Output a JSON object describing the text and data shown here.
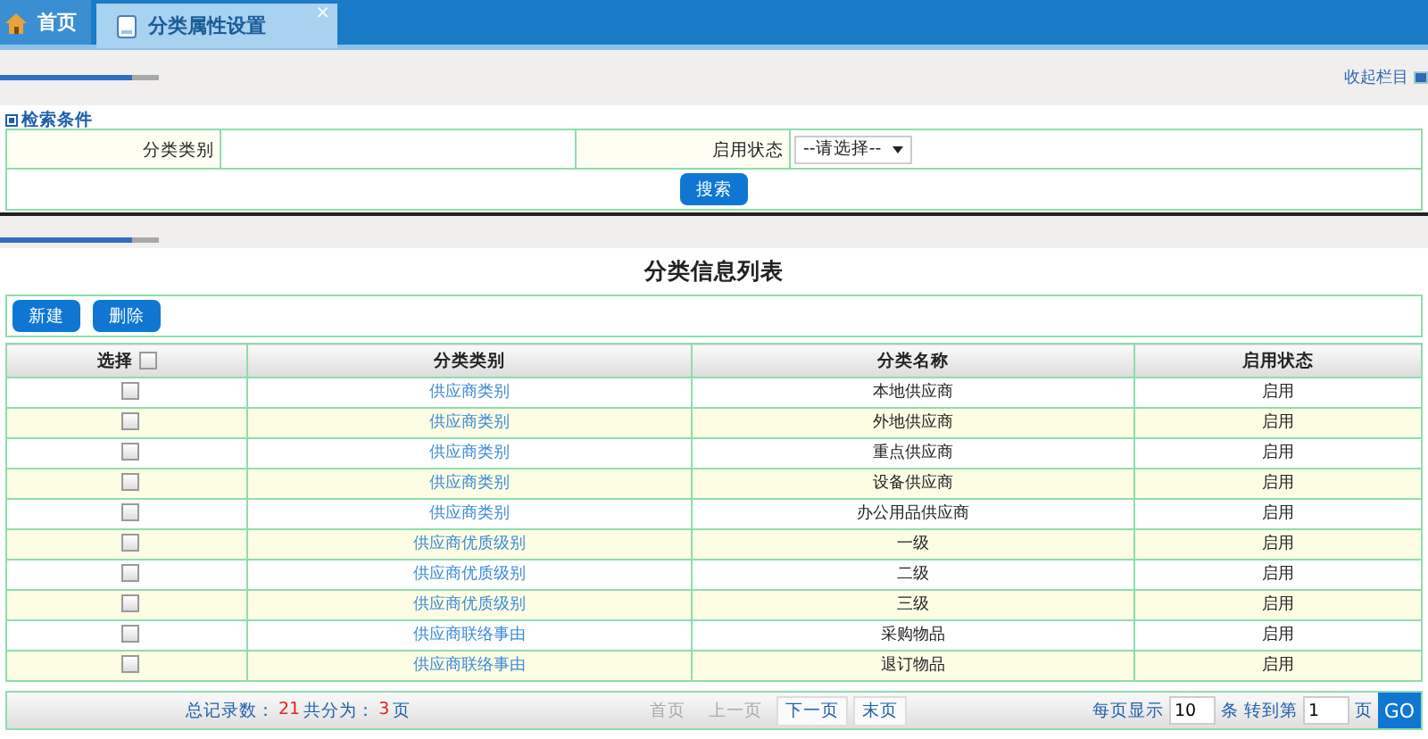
{
  "tabs": [
    {
      "label": "首页",
      "kind": "home",
      "selected": false
    },
    {
      "label": "分类属性设置",
      "kind": "page",
      "selected": true,
      "close": "×"
    }
  ],
  "collapse_link": "收起栏目",
  "search": {
    "title": "检索条件",
    "fields": [
      {
        "label": "分类类别",
        "kind": "text"
      },
      {
        "label": "启用状态",
        "kind": "select",
        "value": "--请选择--"
      }
    ],
    "button": "搜索"
  },
  "list": {
    "title": "分类信息列表",
    "buttons": [
      "新建",
      "删除"
    ],
    "columns": [
      {
        "label": "选择",
        "checked": false
      },
      {
        "label": "分类类别"
      },
      {
        "label": "分类名称"
      },
      {
        "label": "启用状态"
      }
    ],
    "rows": [
      {
        "checked": false,
        "category": "供应商类别",
        "name": "本地供应商",
        "status": "启用"
      },
      {
        "checked": false,
        "category": "供应商类别",
        "name": "外地供应商",
        "status": "启用"
      },
      {
        "checked": false,
        "category": "供应商类别",
        "name": "重点供应商",
        "status": "启用"
      },
      {
        "checked": false,
        "category": "供应商类别",
        "name": "设备供应商",
        "status": "启用"
      },
      {
        "checked": false,
        "category": "供应商类别",
        "name": "办公用品供应商",
        "status": "启用"
      },
      {
        "checked": false,
        "category": "供应商优质级别",
        "name": "一级",
        "status": "启用"
      },
      {
        "checked": false,
        "category": "供应商优质级别",
        "name": "二级",
        "status": "启用"
      },
      {
        "checked": false,
        "category": "供应商优质级别",
        "name": "三级",
        "status": "启用"
      },
      {
        "checked": false,
        "category": "供应商联络事由",
        "name": "采购物品",
        "status": "启用"
      },
      {
        "checked": false,
        "category": "供应商联络事由",
        "name": "退订物品",
        "status": "启用"
      }
    ]
  },
  "pager": {
    "total_label": "总记录数：",
    "total": "21",
    "pages_label": "共分为：",
    "pages": "3",
    "pages_unit": "页",
    "nav": [
      {
        "label": "首页",
        "disabled": true
      },
      {
        "label": "上一页",
        "disabled": true
      },
      {
        "label": "下一页",
        "disabled": false
      },
      {
        "label": "末页",
        "disabled": false
      }
    ],
    "per_page_label": "每页显示",
    "per_page": "10",
    "per_page_unit": "条",
    "goto_label": "转到第",
    "goto_page": "1",
    "goto_unit": "页",
    "go": "GO"
  }
}
